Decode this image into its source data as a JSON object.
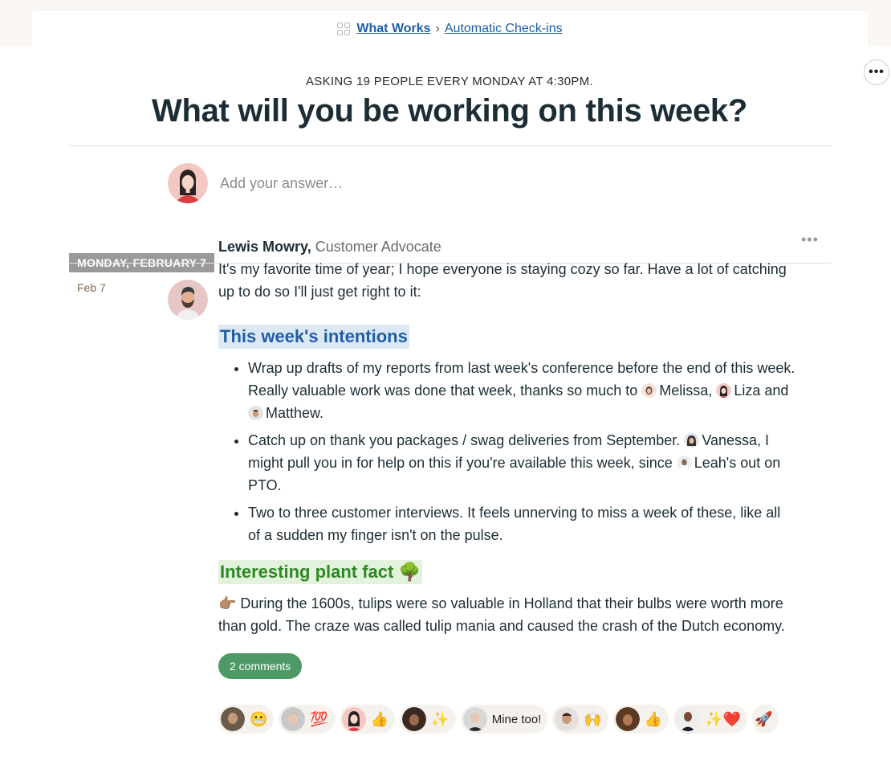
{
  "breadcrumb": {
    "project": "What Works",
    "separator": "›",
    "tool": "Automatic Check-ins"
  },
  "header": {
    "more_label": "•••",
    "asking": "ASKING 19 PEOPLE EVERY MONDAY AT 4:30PM.",
    "question": "What will you be working on this week?"
  },
  "answer": {
    "placeholder": "Add your answer…"
  },
  "day": {
    "label": "MONDAY, FEBRUARY 7",
    "date": "Feb 7"
  },
  "entry": {
    "author_name": "Lewis Mowry,",
    "author_title": "Customer Advocate",
    "more_label": "•••",
    "intro": "It's my favorite time of year; I hope everyone is staying cozy so far. Have a lot of catching up to do so I'll just get right to it:",
    "intentions_heading": "This week's intentions",
    "bullets": {
      "b1_text": "Wrap up drafts of my reports from last week's conference before the end of this week. Really valuable work was done that week, thanks so much to",
      "b1_mention1": "Melissa,",
      "b1_mention2": "Liza",
      "b1_and": "and",
      "b1_mention3": "Matthew.",
      "b2_text": "Catch up on thank you packages / swag deliveries from September.",
      "b2_mention1": "Vanessa,",
      "b2_mid": "I might pull you in for help on this if you're available this week, since",
      "b2_mention2": "Leah's out on PTO.",
      "b3_text": "Two to three customer interviews. It feels unnerving to miss a week of these, like all of a sudden my finger isn't on the pulse."
    },
    "plant_heading": "Interesting plant fact 🌳",
    "fact": "👉🏽 During the 1600s, tulips were so valuable in Holland that their bulbs were worth more than gold. The craze was called tulip mania and caused the crash of the Dutch economy.",
    "comments_label": "2 comments"
  },
  "boosts": {
    "b1": "😬",
    "b2": "💯",
    "b3": "👍",
    "b4": "✨",
    "b5": "Mine too!",
    "b6": "🙌",
    "b7": "👍",
    "b8": "✨❤️",
    "b9": "🚀"
  },
  "colors": {
    "link": "#1f5ea6",
    "intentions_bg": "#dde8f5",
    "plant_text": "#2e8a24",
    "plant_bg": "#e2f2dc",
    "comments_bg": "#4e9a66",
    "day_label_bg": "#9a9a9a"
  }
}
